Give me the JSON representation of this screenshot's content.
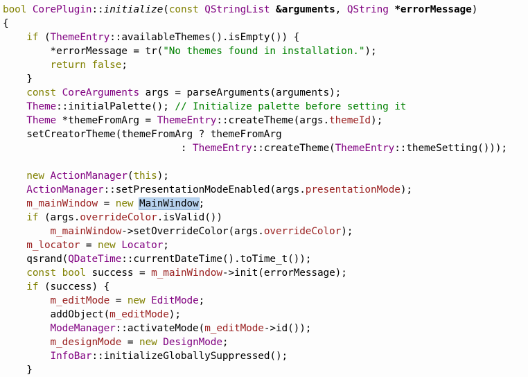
{
  "editor": {
    "background_color": "#fdfdfd",
    "default_text_color": "#000000",
    "selection_highlight_color": "#b8d3ef",
    "language": "C++",
    "palette": {
      "keyword": "#808000",
      "type": "#800080",
      "class": "#800080",
      "string": "#008000",
      "comment": "#008000",
      "member_variable": "#9a2020",
      "plain": "#000000"
    }
  },
  "code": {
    "lines": [
      {
        "index": 1,
        "text": "bool CorePlugin::initialize(const QStringList &arguments, QString *errorMessage)",
        "tokens": [
          {
            "text": "bool",
            "role": "keyword"
          },
          {
            "text": " ",
            "role": "plain"
          },
          {
            "text": "CorePlugin",
            "role": "class"
          },
          {
            "text": "::",
            "role": "plain"
          },
          {
            "text": "initialize",
            "role": "func-decl"
          },
          {
            "text": "(",
            "role": "plain"
          },
          {
            "text": "const",
            "role": "keyword"
          },
          {
            "text": " ",
            "role": "plain"
          },
          {
            "text": "QStringList",
            "role": "type"
          },
          {
            "text": " ",
            "role": "plain"
          },
          {
            "text": "&arguments",
            "role": "param"
          },
          {
            "text": ", ",
            "role": "plain"
          },
          {
            "text": "QString",
            "role": "type"
          },
          {
            "text": " ",
            "role": "plain"
          },
          {
            "text": "*errorMessage",
            "role": "param"
          },
          {
            "text": ")",
            "role": "plain"
          }
        ]
      },
      {
        "index": 2,
        "text": "{",
        "tokens": [
          {
            "text": "{",
            "role": "plain"
          }
        ]
      },
      {
        "index": 3,
        "text": "    if (ThemeEntry::availableThemes().isEmpty()) {",
        "tokens": [
          {
            "text": "    ",
            "role": "plain"
          },
          {
            "text": "if",
            "role": "keyword"
          },
          {
            "text": " (",
            "role": "plain"
          },
          {
            "text": "ThemeEntry",
            "role": "class"
          },
          {
            "text": "::availableThemes().isEmpty()) {",
            "role": "plain"
          }
        ]
      },
      {
        "index": 4,
        "text": "        *errorMessage = tr(\"No themes found in installation.\");",
        "tokens": [
          {
            "text": "        *errorMessage = tr(",
            "role": "plain"
          },
          {
            "text": "\"No themes found in installation.\"",
            "role": "string"
          },
          {
            "text": ");",
            "role": "plain"
          }
        ]
      },
      {
        "index": 5,
        "text": "        return false;",
        "tokens": [
          {
            "text": "        ",
            "role": "plain"
          },
          {
            "text": "return",
            "role": "keyword"
          },
          {
            "text": " ",
            "role": "plain"
          },
          {
            "text": "false",
            "role": "keyword"
          },
          {
            "text": ";",
            "role": "plain"
          }
        ]
      },
      {
        "index": 6,
        "text": "    }",
        "tokens": [
          {
            "text": "    }",
            "role": "plain"
          }
        ]
      },
      {
        "index": 7,
        "text": "    const CoreArguments args = parseArguments(arguments);",
        "tokens": [
          {
            "text": "    ",
            "role": "plain"
          },
          {
            "text": "const",
            "role": "keyword"
          },
          {
            "text": " ",
            "role": "plain"
          },
          {
            "text": "CoreArguments",
            "role": "class"
          },
          {
            "text": " args = parseArguments(arguments);",
            "role": "plain"
          }
        ]
      },
      {
        "index": 8,
        "text": "    Theme::initialPalette(); // Initialize palette before setting it",
        "tokens": [
          {
            "text": "    ",
            "role": "plain"
          },
          {
            "text": "Theme",
            "role": "class"
          },
          {
            "text": "::initialPalette(); ",
            "role": "plain"
          },
          {
            "text": "// Initialize palette before setting it",
            "role": "comment"
          }
        ]
      },
      {
        "index": 9,
        "text": "    Theme *themeFromArg = ThemeEntry::createTheme(args.themeId);",
        "tokens": [
          {
            "text": "    ",
            "role": "plain"
          },
          {
            "text": "Theme",
            "role": "class"
          },
          {
            "text": " *themeFromArg = ",
            "role": "plain"
          },
          {
            "text": "ThemeEntry",
            "role": "class"
          },
          {
            "text": "::createTheme(args.",
            "role": "plain"
          },
          {
            "text": "themeId",
            "role": "member"
          },
          {
            "text": ");",
            "role": "plain"
          }
        ]
      },
      {
        "index": 10,
        "text": "    setCreatorTheme(themeFromArg ? themeFromArg",
        "tokens": [
          {
            "text": "    setCreatorTheme(themeFromArg ? themeFromArg",
            "role": "plain"
          }
        ]
      },
      {
        "index": 11,
        "text": "                              : ThemeEntry::createTheme(ThemeEntry::themeSetting()));",
        "tokens": [
          {
            "text": "                              : ",
            "role": "plain"
          },
          {
            "text": "ThemeEntry",
            "role": "class"
          },
          {
            "text": "::createTheme(",
            "role": "plain"
          },
          {
            "text": "ThemeEntry",
            "role": "class"
          },
          {
            "text": "::themeSetting()));",
            "role": "plain"
          }
        ]
      },
      {
        "index": 12,
        "text": "",
        "tokens": []
      },
      {
        "index": 13,
        "text": "    new ActionManager(this);",
        "tokens": [
          {
            "text": "    ",
            "role": "plain"
          },
          {
            "text": "new",
            "role": "keyword"
          },
          {
            "text": " ",
            "role": "plain"
          },
          {
            "text": "ActionManager",
            "role": "class"
          },
          {
            "text": "(",
            "role": "plain"
          },
          {
            "text": "this",
            "role": "keyword"
          },
          {
            "text": ");",
            "role": "plain"
          }
        ]
      },
      {
        "index": 14,
        "text": "    ActionManager::setPresentationModeEnabled(args.presentationMode);",
        "tokens": [
          {
            "text": "    ",
            "role": "plain"
          },
          {
            "text": "ActionManager",
            "role": "class"
          },
          {
            "text": "::setPresentationModeEnabled(args.",
            "role": "plain"
          },
          {
            "text": "presentationMode",
            "role": "member"
          },
          {
            "text": ");",
            "role": "plain"
          }
        ]
      },
      {
        "index": 15,
        "text": "    m_mainWindow = new MainWindow;",
        "tokens": [
          {
            "text": "    ",
            "role": "plain"
          },
          {
            "text": "m_mainWindow",
            "role": "member"
          },
          {
            "text": " = ",
            "role": "plain"
          },
          {
            "text": "new",
            "role": "keyword"
          },
          {
            "text": " ",
            "role": "plain"
          },
          {
            "text": "MainWindow",
            "role": "highlight"
          },
          {
            "text": ";",
            "role": "plain"
          }
        ]
      },
      {
        "index": 16,
        "text": "    if (args.overrideColor.isValid())",
        "tokens": [
          {
            "text": "    ",
            "role": "plain"
          },
          {
            "text": "if",
            "role": "keyword"
          },
          {
            "text": " (args.",
            "role": "plain"
          },
          {
            "text": "overrideColor",
            "role": "member"
          },
          {
            "text": ".isValid())",
            "role": "plain"
          }
        ]
      },
      {
        "index": 17,
        "text": "        m_mainWindow->setOverrideColor(args.overrideColor);",
        "tokens": [
          {
            "text": "        ",
            "role": "plain"
          },
          {
            "text": "m_mainWindow",
            "role": "member"
          },
          {
            "text": "->setOverrideColor(args.",
            "role": "plain"
          },
          {
            "text": "overrideColor",
            "role": "member"
          },
          {
            "text": ");",
            "role": "plain"
          }
        ]
      },
      {
        "index": 18,
        "text": "    m_locator = new Locator;",
        "tokens": [
          {
            "text": "    ",
            "role": "plain"
          },
          {
            "text": "m_locator",
            "role": "member"
          },
          {
            "text": " = ",
            "role": "plain"
          },
          {
            "text": "new",
            "role": "keyword"
          },
          {
            "text": " ",
            "role": "plain"
          },
          {
            "text": "Locator",
            "role": "class"
          },
          {
            "text": ";",
            "role": "plain"
          }
        ]
      },
      {
        "index": 19,
        "text": "    qsrand(QDateTime::currentDateTime().toTime_t());",
        "tokens": [
          {
            "text": "    qsrand(",
            "role": "plain"
          },
          {
            "text": "QDateTime",
            "role": "class"
          },
          {
            "text": "::currentDateTime().toTime_t());",
            "role": "plain"
          }
        ]
      },
      {
        "index": 20,
        "text": "    const bool success = m_mainWindow->init(errorMessage);",
        "tokens": [
          {
            "text": "    ",
            "role": "plain"
          },
          {
            "text": "const",
            "role": "keyword"
          },
          {
            "text": " ",
            "role": "plain"
          },
          {
            "text": "bool",
            "role": "keyword"
          },
          {
            "text": " success = ",
            "role": "plain"
          },
          {
            "text": "m_mainWindow",
            "role": "member"
          },
          {
            "text": "->init(errorMessage);",
            "role": "plain"
          }
        ]
      },
      {
        "index": 21,
        "text": "    if (success) {",
        "tokens": [
          {
            "text": "    ",
            "role": "plain"
          },
          {
            "text": "if",
            "role": "keyword"
          },
          {
            "text": " (success) {",
            "role": "plain"
          }
        ]
      },
      {
        "index": 22,
        "text": "        m_editMode = new EditMode;",
        "tokens": [
          {
            "text": "        ",
            "role": "plain"
          },
          {
            "text": "m_editMode",
            "role": "member"
          },
          {
            "text": " = ",
            "role": "plain"
          },
          {
            "text": "new",
            "role": "keyword"
          },
          {
            "text": " ",
            "role": "plain"
          },
          {
            "text": "EditMode",
            "role": "class"
          },
          {
            "text": ";",
            "role": "plain"
          }
        ]
      },
      {
        "index": 23,
        "text": "        addObject(m_editMode);",
        "tokens": [
          {
            "text": "        addObject(",
            "role": "plain"
          },
          {
            "text": "m_editMode",
            "role": "member"
          },
          {
            "text": ");",
            "role": "plain"
          }
        ]
      },
      {
        "index": 24,
        "text": "        ModeManager::activateMode(m_editMode->id());",
        "tokens": [
          {
            "text": "        ",
            "role": "plain"
          },
          {
            "text": "ModeManager",
            "role": "class"
          },
          {
            "text": "::activateMode(",
            "role": "plain"
          },
          {
            "text": "m_editMode",
            "role": "member"
          },
          {
            "text": "->id());",
            "role": "plain"
          }
        ]
      },
      {
        "index": 25,
        "text": "        m_designMode = new DesignMode;",
        "tokens": [
          {
            "text": "        ",
            "role": "plain"
          },
          {
            "text": "m_designMode",
            "role": "member"
          },
          {
            "text": " = ",
            "role": "plain"
          },
          {
            "text": "new",
            "role": "keyword"
          },
          {
            "text": " ",
            "role": "plain"
          },
          {
            "text": "DesignMode",
            "role": "class"
          },
          {
            "text": ";",
            "role": "plain"
          }
        ]
      },
      {
        "index": 26,
        "text": "        InfoBar::initializeGloballySuppressed();",
        "tokens": [
          {
            "text": "        ",
            "role": "plain"
          },
          {
            "text": "InfoBar",
            "role": "class"
          },
          {
            "text": "::initializeGloballySuppressed();",
            "role": "plain"
          }
        ]
      },
      {
        "index": 27,
        "text": "    }",
        "tokens": [
          {
            "text": "    }",
            "role": "plain"
          }
        ]
      }
    ]
  }
}
